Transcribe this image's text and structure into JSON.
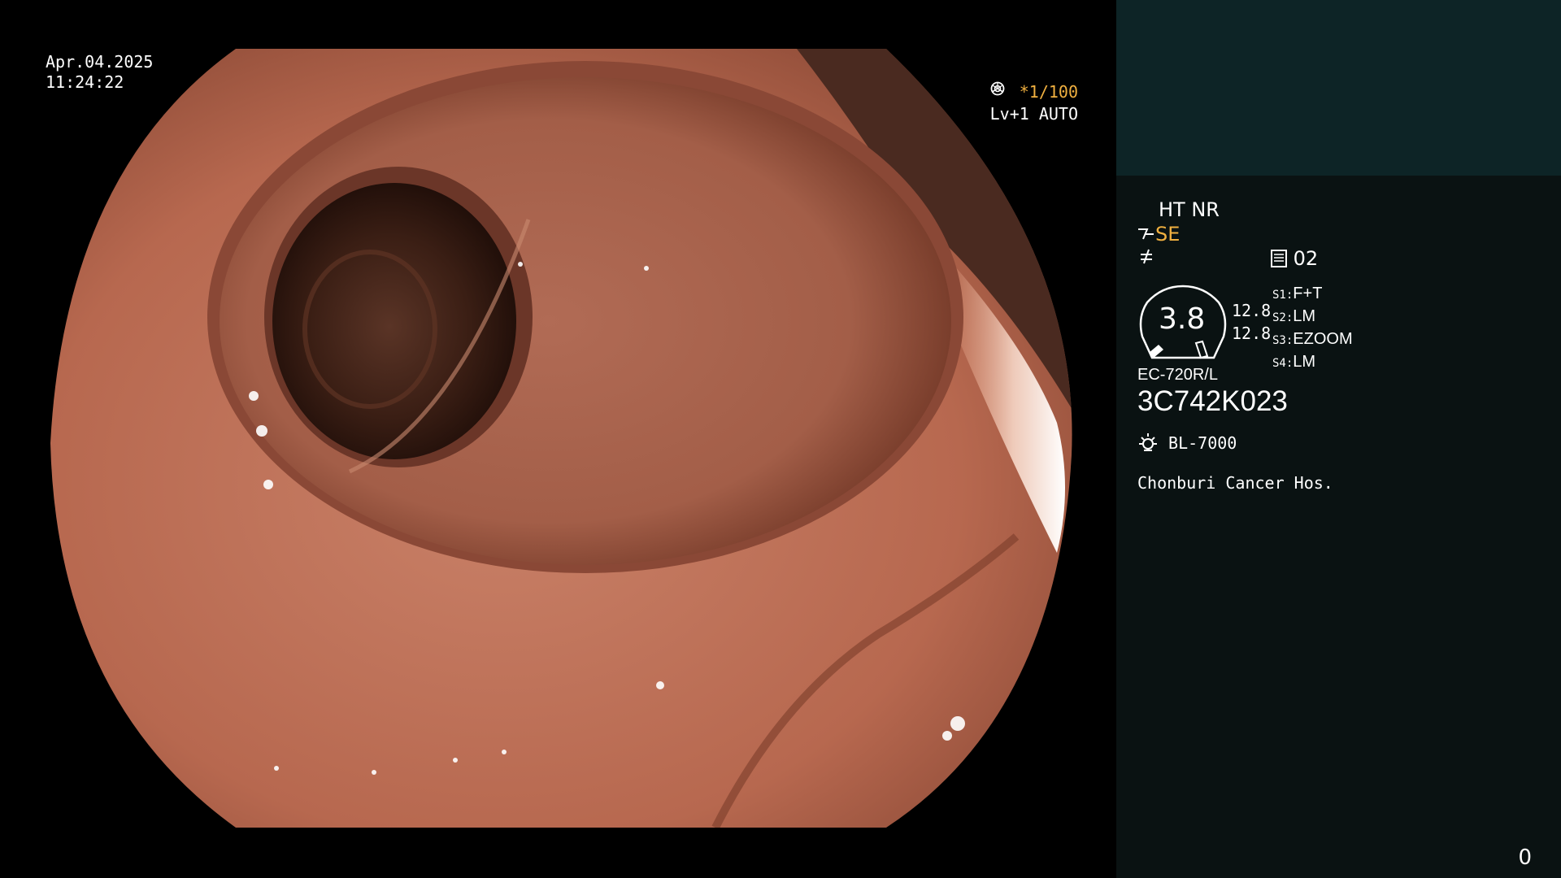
{
  "overlay": {
    "date": "Apr.04.2025",
    "time": "11:24:22",
    "shutter": "*1/100",
    "shutter_icon": "shutter-icon",
    "level": "Lv+1 AUTO",
    "auto_icon": "iris-icon"
  },
  "panel": {
    "ht_nr": "HT NR",
    "se": "SE",
    "se_icon": "enhance-icon",
    "filter_icon": "filter-icon",
    "memory_icon": "memory-card-icon",
    "memory": "02",
    "gauge_value": "3.8",
    "gauge_value_a": "12.8",
    "gauge_value_b": "12.8",
    "switches": [
      {
        "key": "S1",
        "value": "F+T"
      },
      {
        "key": "S2",
        "value": "LM"
      },
      {
        "key": "S3",
        "value": "EZOOM"
      },
      {
        "key": "S4",
        "value": "LM"
      }
    ],
    "scope_model": "EC-720R/L",
    "serial": "3C742K023",
    "light_icon": "lamp-icon",
    "light_source": "BL-7000",
    "hospital": "Chonburi Cancer Hos.",
    "counter": "0"
  },
  "colors": {
    "tissue": "#c07258",
    "lumen_dark": "#2a140e",
    "highlight_text": "#f0b040"
  }
}
